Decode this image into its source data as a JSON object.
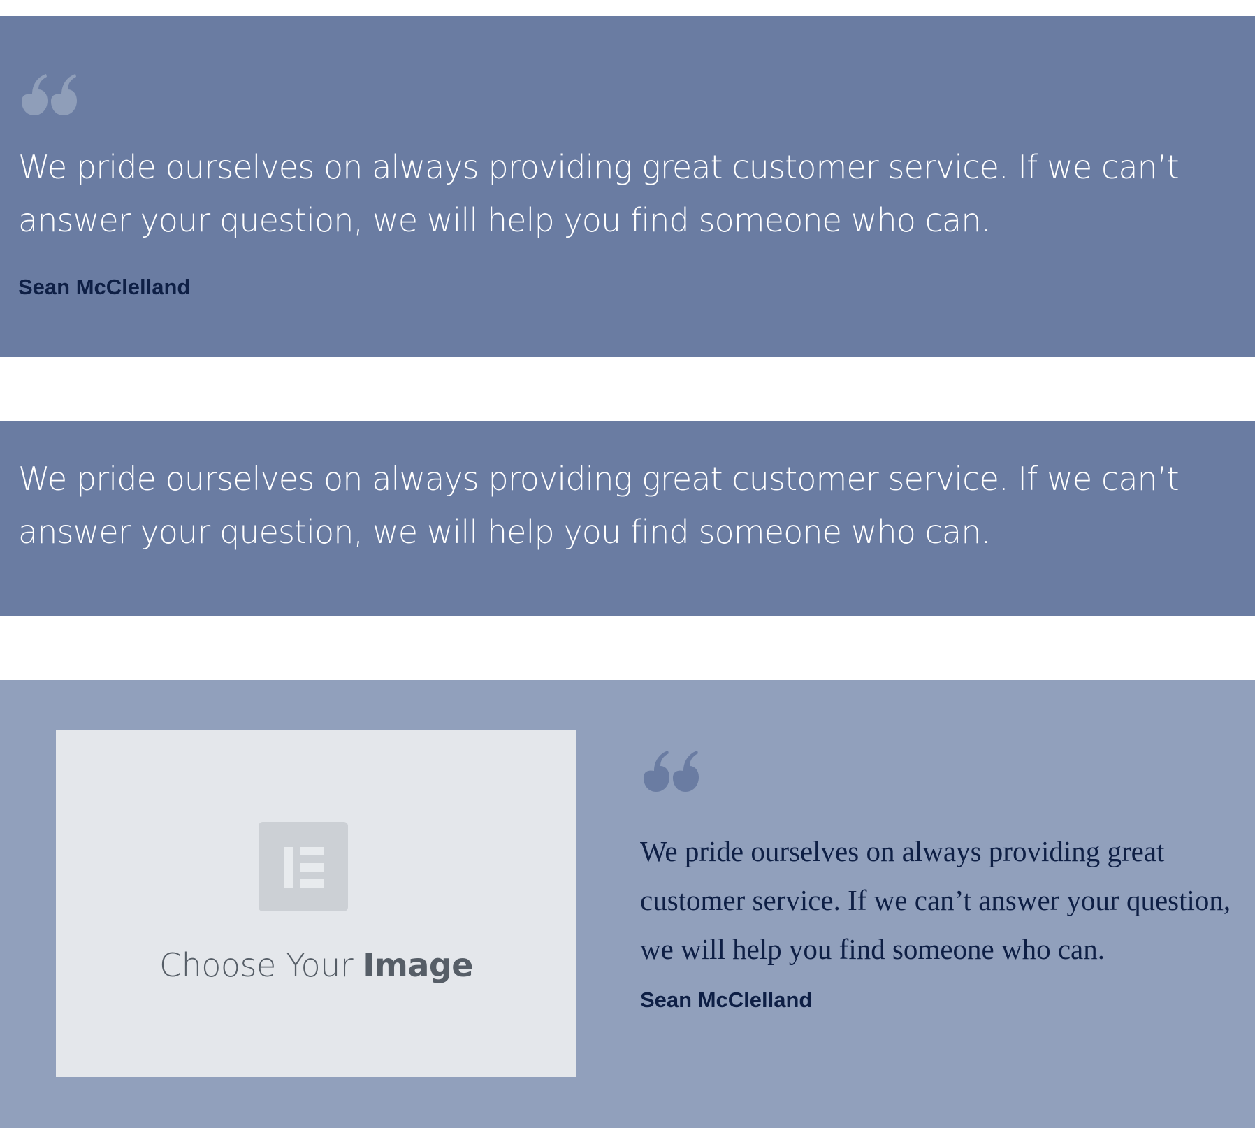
{
  "testimonial_1": {
    "quote": "We pride ourselves on always providing great customer service. If we can’t answer your question, we will help you find someone who can.",
    "author": "Sean McClelland"
  },
  "testimonial_2": {
    "quote": "We pride ourselves on always providing great customer service. If we can’t answer your question, we will help you find someone who can."
  },
  "testimonial_3": {
    "image_placeholder": {
      "caption_light": "Choose Your ",
      "caption_bold": "Image",
      "icon": "elementor-logo-icon"
    },
    "quote": "We pride ourselves on always providing great customer service. If we can’t answer your question, we will help you find someone who can.",
    "author": "Sean McClelland"
  },
  "colors": {
    "band_dark": "#6a7ca2",
    "band_light": "#91a0bc",
    "author_text": "#0e1f45",
    "quote_mark_on_dark": "#8f9eb9",
    "quote_mark_on_light": "#6a7ca2",
    "placeholder_bg": "#e4e7eb"
  }
}
